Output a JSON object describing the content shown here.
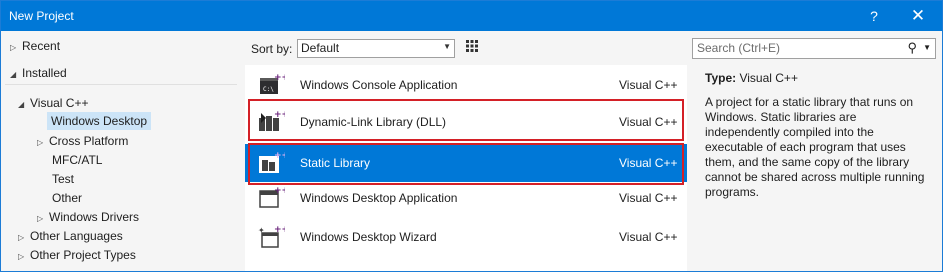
{
  "window": {
    "title": "New Project",
    "help_glyph": "?",
    "close_glyph": "✕"
  },
  "tree": {
    "items": [
      {
        "label": "Recent",
        "arrow": "▷"
      },
      {
        "label": "Installed",
        "arrow": "◢"
      },
      {
        "label": "Visual C++",
        "arrow": "◢"
      },
      {
        "label": "Windows Desktop",
        "arrow": ""
      },
      {
        "label": "Cross Platform",
        "arrow": "▷"
      },
      {
        "label": "MFC/ATL",
        "arrow": ""
      },
      {
        "label": "Test",
        "arrow": ""
      },
      {
        "label": "Other",
        "arrow": ""
      },
      {
        "label": "Windows Drivers",
        "arrow": "▷"
      },
      {
        "label": "Other Languages",
        "arrow": "▷"
      },
      {
        "label": "Other Project Types",
        "arrow": "▷"
      }
    ]
  },
  "toolbar": {
    "sort_label": "Sort by:",
    "sort_value": "Default",
    "search_placeholder": "Search (Ctrl+E)"
  },
  "templates": [
    {
      "name": "Windows Console Application",
      "lang": "Visual C++",
      "icon": "console-app-icon"
    },
    {
      "name": "Dynamic-Link Library (DLL)",
      "lang": "Visual C++",
      "icon": "dll-icon"
    },
    {
      "name": "Static Library",
      "lang": "Visual C++",
      "icon": "static-library-icon"
    },
    {
      "name": "Windows Desktop Application",
      "lang": "Visual C++",
      "icon": "desktop-app-icon"
    },
    {
      "name": "Windows Desktop Wizard",
      "lang": "Visual C++",
      "icon": "desktop-wizard-icon"
    }
  ],
  "details": {
    "type_label": "Type:",
    "type_value": "Visual C++",
    "description": "A project for a static library that runs on Windows. Static libraries are independently compiled into the executable of each program that uses them, and the same copy of the library cannot be shared across multiple running programs."
  },
  "colors": {
    "accent": "#0078d7",
    "highlight_border": "#d42027",
    "selected_tree": "#cce4f7"
  }
}
